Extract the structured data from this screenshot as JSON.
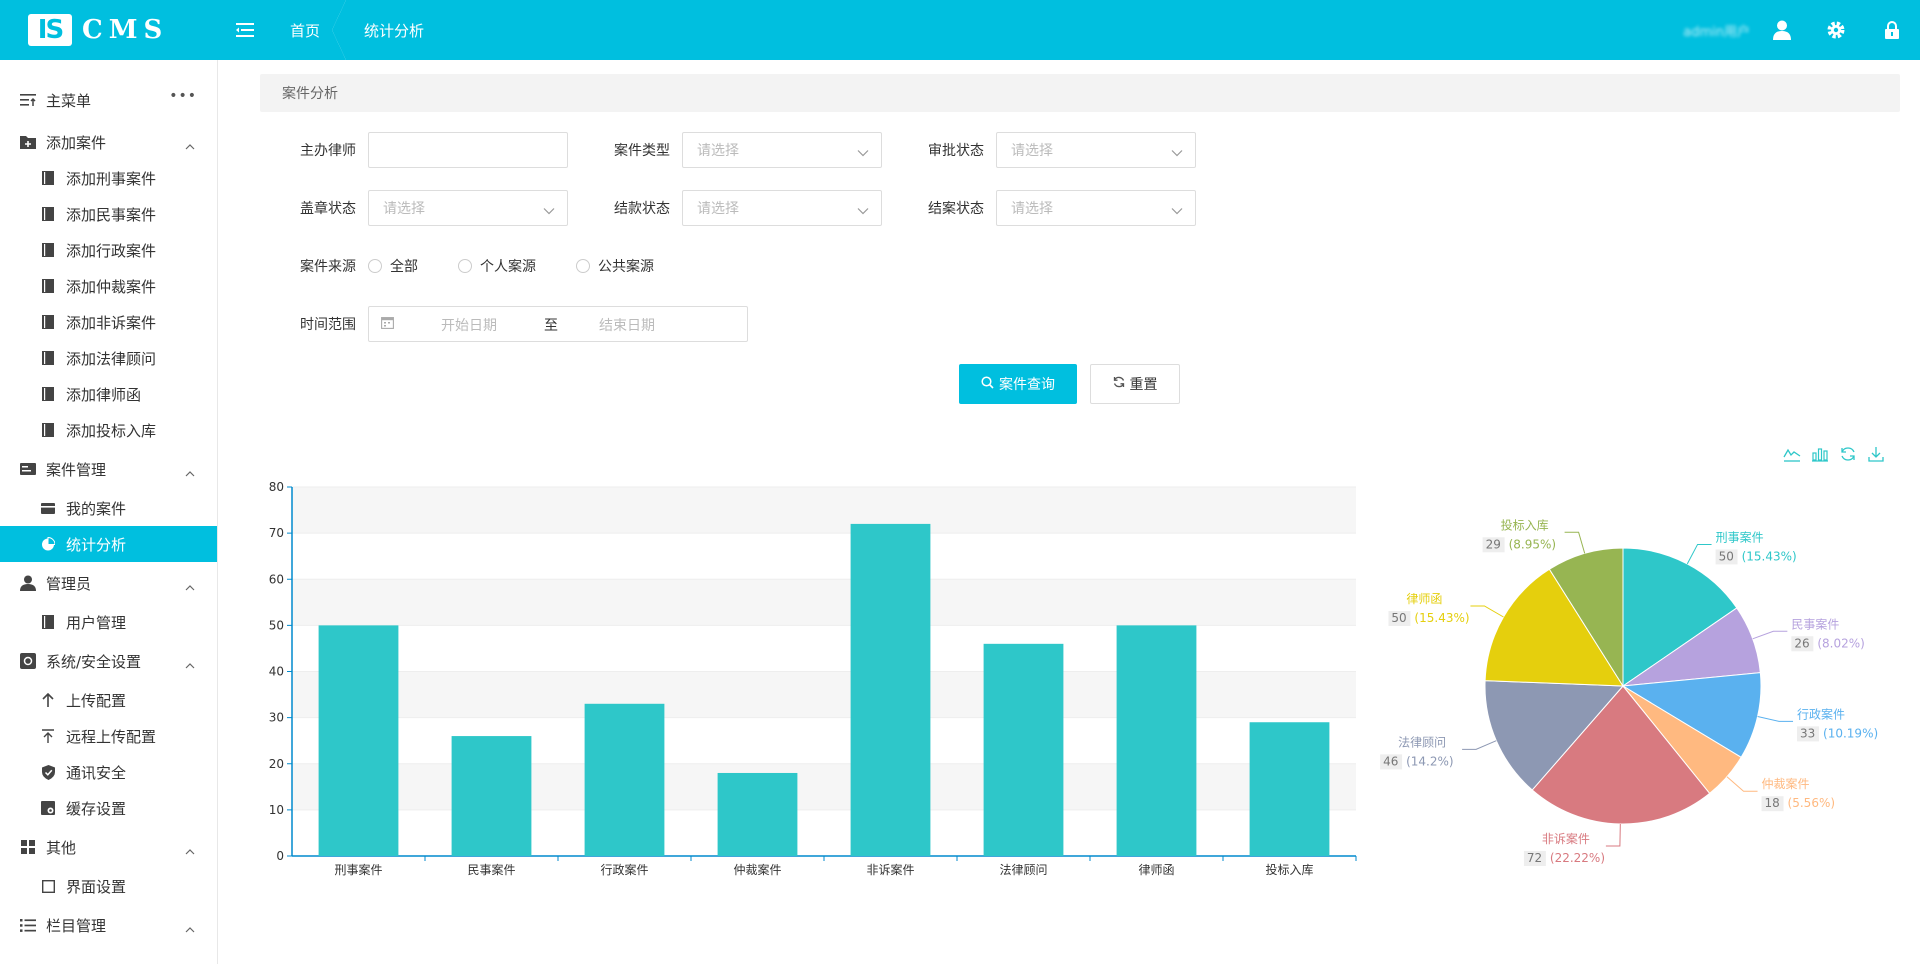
{
  "app": {
    "logo_mark": "IS",
    "logo_text": "CMS",
    "username": "admin用户"
  },
  "breadcrumb": {
    "home": "首页",
    "current": "统计分析"
  },
  "sidebar": {
    "main_menu": "主菜单",
    "groups": [
      {
        "label": "添加案件",
        "items": [
          "添加刑事案件",
          "添加民事案件",
          "添加行政案件",
          "添加仲裁案件",
          "添加非诉案件",
          "添加法律顾问",
          "添加律师函",
          "添加投标入库"
        ]
      },
      {
        "label": "案件管理",
        "items": [
          "我的案件",
          "统计分析"
        ]
      },
      {
        "label": "管理员",
        "items": [
          "用户管理"
        ]
      },
      {
        "label": "系统/安全设置",
        "items": [
          "上传配置",
          "远程上传配置",
          "通讯安全",
          "缓存设置"
        ]
      },
      {
        "label": "其他",
        "items": [
          "界面设置"
        ]
      },
      {
        "label": "栏目管理",
        "items": []
      }
    ]
  },
  "panel": {
    "title": "案件分析"
  },
  "form": {
    "lawyer_label": "主办律师",
    "case_type_label": "案件类型",
    "approval_label": "审批状态",
    "seal_label": "盖章状态",
    "payment_label": "结款状态",
    "closing_label": "结案状态",
    "select_placeholder": "请选择",
    "source_label": "案件来源",
    "source_options": [
      "全部",
      "个人案源",
      "公共案源"
    ],
    "time_label": "时间范围",
    "start_placeholder": "开始日期",
    "range_sep": "至",
    "end_placeholder": "结束日期",
    "search_button": "案件查询",
    "reset_button": "重置"
  },
  "colors": {
    "accent": "#00bfdf",
    "bar": "#2ec7c9"
  },
  "chart_data": [
    {
      "type": "bar",
      "categories": [
        "刑事案件",
        "民事案件",
        "行政案件",
        "仲裁案件",
        "非诉案件",
        "法律顾问",
        "律师函",
        "投标入库"
      ],
      "values": [
        50,
        26,
        33,
        18,
        72,
        46,
        50,
        29
      ],
      "ylim": [
        0,
        80
      ],
      "yticks": [
        0,
        10,
        20,
        30,
        40,
        50,
        60,
        70,
        80
      ],
      "grid": true
    },
    {
      "type": "pie",
      "slices": [
        {
          "name": "刑事案件",
          "value": 50,
          "percent": "(15.43%)",
          "color": "#2ec7c9"
        },
        {
          "name": "民事案件",
          "value": 26,
          "percent": "(8.02%)",
          "color": "#b6a2de"
        },
        {
          "name": "行政案件",
          "value": 33,
          "percent": "(10.19%)",
          "color": "#5ab1ef"
        },
        {
          "name": "仲裁案件",
          "value": 18,
          "percent": "(5.56%)",
          "color": "#ffb980"
        },
        {
          "name": "非诉案件",
          "value": 72,
          "percent": "(22.22%)",
          "color": "#d87a80"
        },
        {
          "name": "法律顾问",
          "value": 46,
          "percent": "(14.2%)",
          "color": "#8d98b3"
        },
        {
          "name": "律师函",
          "value": 50,
          "percent": "(15.43%)",
          "color": "#e5cf0d"
        },
        {
          "name": "投标入库",
          "value": 29,
          "percent": "(8.95%)",
          "color": "#97b552"
        }
      ]
    }
  ]
}
